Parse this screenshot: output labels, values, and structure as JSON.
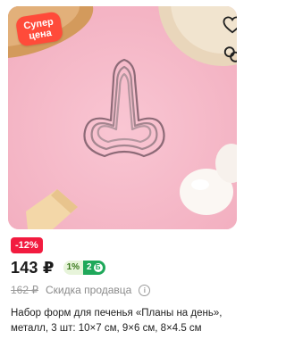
{
  "badge": {
    "line1": "Супер",
    "line2": "цена",
    "color": "#ff4b3a"
  },
  "icons": {
    "favorite": "heart-outline-icon",
    "compare": "compare-rings-icon"
  },
  "discount": {
    "label": "-12%",
    "color": "#f21b3f"
  },
  "price": {
    "current": "143 ₽",
    "old": "162 ₽"
  },
  "loyalty": {
    "percent": "1%",
    "points": "2",
    "coin_symbol": "Б"
  },
  "seller_discount": {
    "label": "Скидка продавца",
    "info_symbol": "i"
  },
  "product": {
    "title": "Набор форм для печенья «Планы на день», металл, 3 шт: 10×7 см, 9×6 см, 8×4.5 см"
  }
}
